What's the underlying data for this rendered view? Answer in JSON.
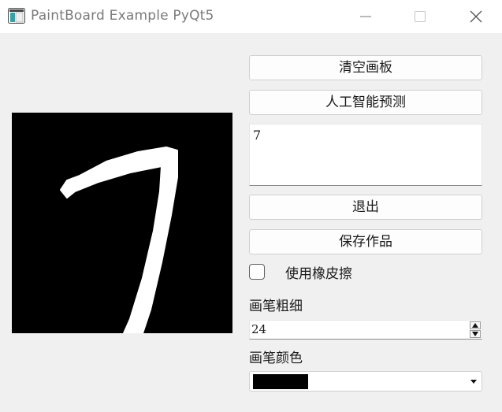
{
  "window": {
    "title": "PaintBoard Example PyQt5",
    "controls": [
      "minimize-icon",
      "maximize-icon",
      "close-icon"
    ]
  },
  "canvas": {
    "background": "#000000",
    "stroke_color": "#ffffff",
    "drawn_digit": "7"
  },
  "buttons": {
    "clear": "清空画板",
    "predict": "人工智能预测",
    "exit": "退出",
    "save": "保存作品"
  },
  "prediction": {
    "value": "7"
  },
  "eraser": {
    "label": "使用橡皮擦",
    "checked": false
  },
  "pen_width": {
    "label": "画笔粗细",
    "value": "24"
  },
  "pen_color": {
    "label": "画笔颜色",
    "value": "#000000"
  }
}
